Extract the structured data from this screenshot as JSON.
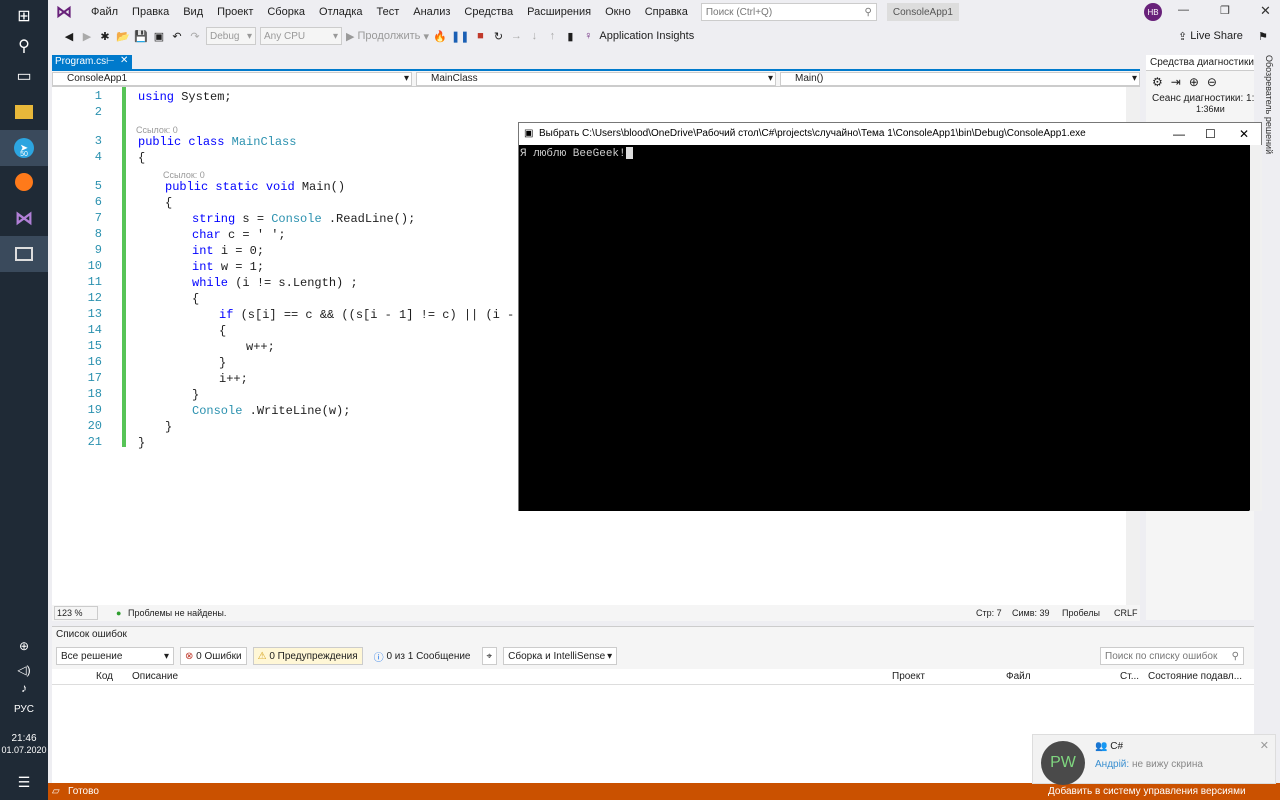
{
  "taskbar": {
    "tray": {
      "lang": "РУС",
      "time": "21:46",
      "date": "01.07.2020"
    },
    "badge": "50"
  },
  "vs": {
    "menu": [
      "Файл",
      "Правка",
      "Вид",
      "Проект",
      "Сборка",
      "Отладка",
      "Тест",
      "Анализ",
      "Средства",
      "Расширения",
      "Окно",
      "Справка"
    ],
    "search_placeholder": "Поиск (Ctrl+Q)",
    "solution_name": "ConsoleApp1",
    "user_initials": "НВ",
    "toolbar": {
      "config": "Debug",
      "platform": "Any CPU",
      "continue": "Продолжить",
      "insights": "Application Insights",
      "liveshare": "Live Share"
    },
    "tab": "Program.cs",
    "nav": {
      "project": "ConsoleApp1",
      "class": "MainClass",
      "member": "Main()"
    },
    "code": [
      {
        "n": "1",
        "parts": [
          [
            "kw",
            "using"
          ],
          [
            "",
            "System;"
          ]
        ],
        "indent": 0
      },
      {
        "n": "2",
        "parts": [],
        "indent": 0
      },
      {
        "n": "3",
        "parts": [
          [
            "kw",
            "public"
          ],
          [
            "kw",
            "class"
          ],
          [
            "type",
            "MainClass"
          ]
        ],
        "indent": 0,
        "ref": "Ссылок: 0"
      },
      {
        "n": "4",
        "parts": [
          [
            "",
            "{"
          ]
        ],
        "indent": 0
      },
      {
        "n": "5",
        "parts": [
          [
            "kw",
            "public"
          ],
          [
            "kw",
            "static"
          ],
          [
            "kw",
            "void"
          ],
          [
            "",
            "Main()"
          ]
        ],
        "indent": 1,
        "ref": "Ссылок: 0"
      },
      {
        "n": "6",
        "parts": [
          [
            "",
            "{"
          ]
        ],
        "indent": 1
      },
      {
        "n": "7",
        "parts": [
          [
            "kw",
            "string"
          ],
          [
            "",
            "s ="
          ],
          [
            "type",
            "Console"
          ],
          [
            "",
            ".ReadLine();"
          ]
        ],
        "indent": 2
      },
      {
        "n": "8",
        "parts": [
          [
            "kw",
            "char"
          ],
          [
            "",
            "c = ' ';"
          ]
        ],
        "indent": 2
      },
      {
        "n": "9",
        "parts": [
          [
            "kw",
            "int"
          ],
          [
            "",
            "i = 0;"
          ]
        ],
        "indent": 2
      },
      {
        "n": "10",
        "parts": [
          [
            "kw",
            "int"
          ],
          [
            "",
            "w = 1;"
          ]
        ],
        "indent": 2
      },
      {
        "n": "11",
        "parts": [
          [
            "kw",
            "while"
          ],
          [
            "",
            "(i != s.Length) ;"
          ]
        ],
        "indent": 2
      },
      {
        "n": "12",
        "parts": [
          [
            "",
            "{"
          ]
        ],
        "indent": 2
      },
      {
        "n": "13",
        "parts": [
          [
            "kw",
            "if"
          ],
          [
            "",
            "(s[i] == c && ((s[i - 1] != c) || (i - 1 <"
          ]
        ],
        "indent": 3
      },
      {
        "n": "14",
        "parts": [
          [
            "",
            "{"
          ]
        ],
        "indent": 3
      },
      {
        "n": "15",
        "parts": [
          [
            "",
            "w++;"
          ]
        ],
        "indent": 4
      },
      {
        "n": "16",
        "parts": [
          [
            "",
            "}"
          ]
        ],
        "indent": 3
      },
      {
        "n": "17",
        "parts": [
          [
            "",
            "i++;"
          ]
        ],
        "indent": 3
      },
      {
        "n": "18",
        "parts": [
          [
            "",
            "}"
          ]
        ],
        "indent": 2
      },
      {
        "n": "19",
        "parts": [
          [
            "type",
            "Console"
          ],
          [
            "",
            ".WriteLine(w);"
          ]
        ],
        "indent": 2
      },
      {
        "n": "20",
        "parts": [
          [
            "",
            "}"
          ]
        ],
        "indent": 1
      },
      {
        "n": "21",
        "parts": [
          [
            "",
            "}"
          ]
        ],
        "indent": 0
      }
    ],
    "status": {
      "zoom": "123 %",
      "problems": "Проблемы не найдены.",
      "row": "Стр: 7",
      "col": "Симв: 39",
      "spaces": "Пробелы",
      "eol": "CRLF"
    },
    "errors": {
      "title": "Список ошибок",
      "scope": "Все решение",
      "errors": "0 Ошибки",
      "warnings": "0 Предупреждения",
      "messages": "0 из 1 Сообщение",
      "build": "Сборка и IntelliSense",
      "search_placeholder": "Поиск по списку ошибок",
      "cols": [
        "Код",
        "Описание",
        "Проект",
        "Файл",
        "Ст...",
        "Состояние подавл..."
      ]
    },
    "diag": {
      "title": "Средства диагностики",
      "session": "Сеанс диагностики: 1:...",
      "time": "1:36ми",
      "side": "Обозреватель решений"
    },
    "statusbar": {
      "ready": "Готово",
      "git": "Добавить в систему управления версиями"
    }
  },
  "console": {
    "title": "Выбрать C:\\Users\\blood\\OneDrive\\Рабочий стол\\C#\\projects\\случайно\\Тема 1\\ConsoleApp1\\bin\\Debug\\ConsoleApp1.exe",
    "output": "Я люблю BeeGeek!"
  },
  "toast": {
    "avatar": "PW",
    "channel": "C#",
    "author": "Андрій:",
    "message": "не вижу скрина"
  }
}
